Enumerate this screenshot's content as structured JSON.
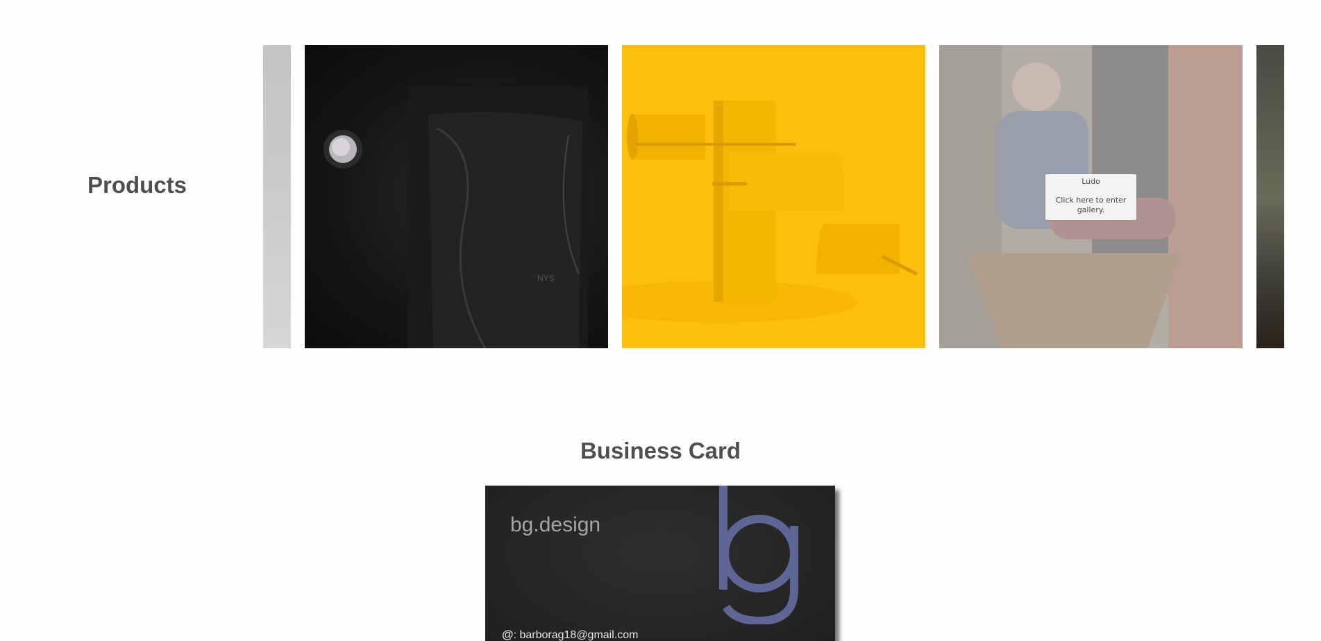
{
  "sections": {
    "products_title": "Products",
    "business_title": "Business Card"
  },
  "gallery": {
    "tiles": [
      {
        "name": "partial-previous",
        "color": "#c6c6c6"
      },
      {
        "name": "black-bag",
        "color": "#161616"
      },
      {
        "name": "yellow-rocking-toy",
        "color": "#fdbf0b"
      },
      {
        "name": "ludo",
        "color": "#a89888"
      },
      {
        "name": "partial-next",
        "color": "#4a4a40"
      }
    ],
    "hover_caption": {
      "title": "Ludo",
      "hint": "Click here to enter gallery."
    }
  },
  "business_card": {
    "brand": "bg.design",
    "email_symbol": "@",
    "email": ": barborag18@gmail.com",
    "logo_color": "#5d6694"
  }
}
